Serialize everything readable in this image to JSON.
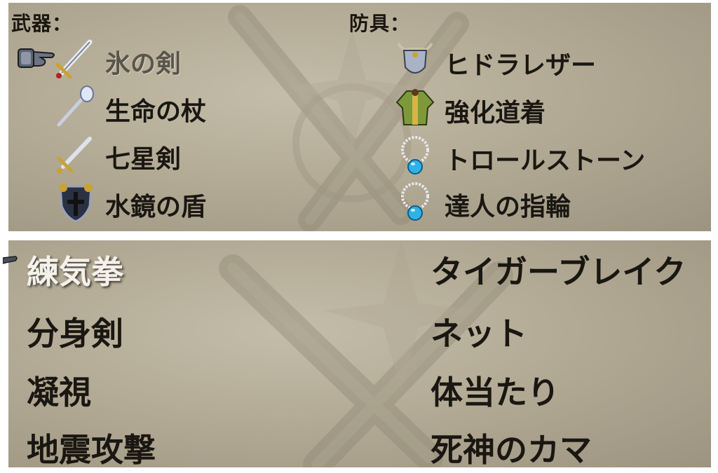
{
  "equipment": {
    "weapons_label": "武器：",
    "armor_label": "防具：",
    "weapons": [
      {
        "name": "氷の剣",
        "icon": "sword-icon",
        "selected": true
      },
      {
        "name": "生命の杖",
        "icon": "staff-icon"
      },
      {
        "name": "七星剣",
        "icon": "sword-icon"
      },
      {
        "name": "水鏡の盾",
        "icon": "shield-icon"
      }
    ],
    "armor": [
      {
        "name": "ヒドラレザー",
        "icon": "armor-icon"
      },
      {
        "name": "強化道着",
        "icon": "robe-icon"
      },
      {
        "name": "トロールストーン",
        "icon": "necklace-icon"
      },
      {
        "name": "達人の指輪",
        "icon": "necklace-icon"
      }
    ]
  },
  "skills": {
    "left": [
      "練気拳",
      "分身剣",
      "凝視",
      "地震攻撃"
    ],
    "right": [
      "タイガーブレイク",
      "ネット",
      "体当たり",
      "死神のカマ"
    ]
  },
  "colors": {
    "panel_bg": "#b3ab95",
    "text": "#1a1712",
    "selected_skill_text": "#f4f1ea",
    "dim_item_text": "#5a554c"
  }
}
